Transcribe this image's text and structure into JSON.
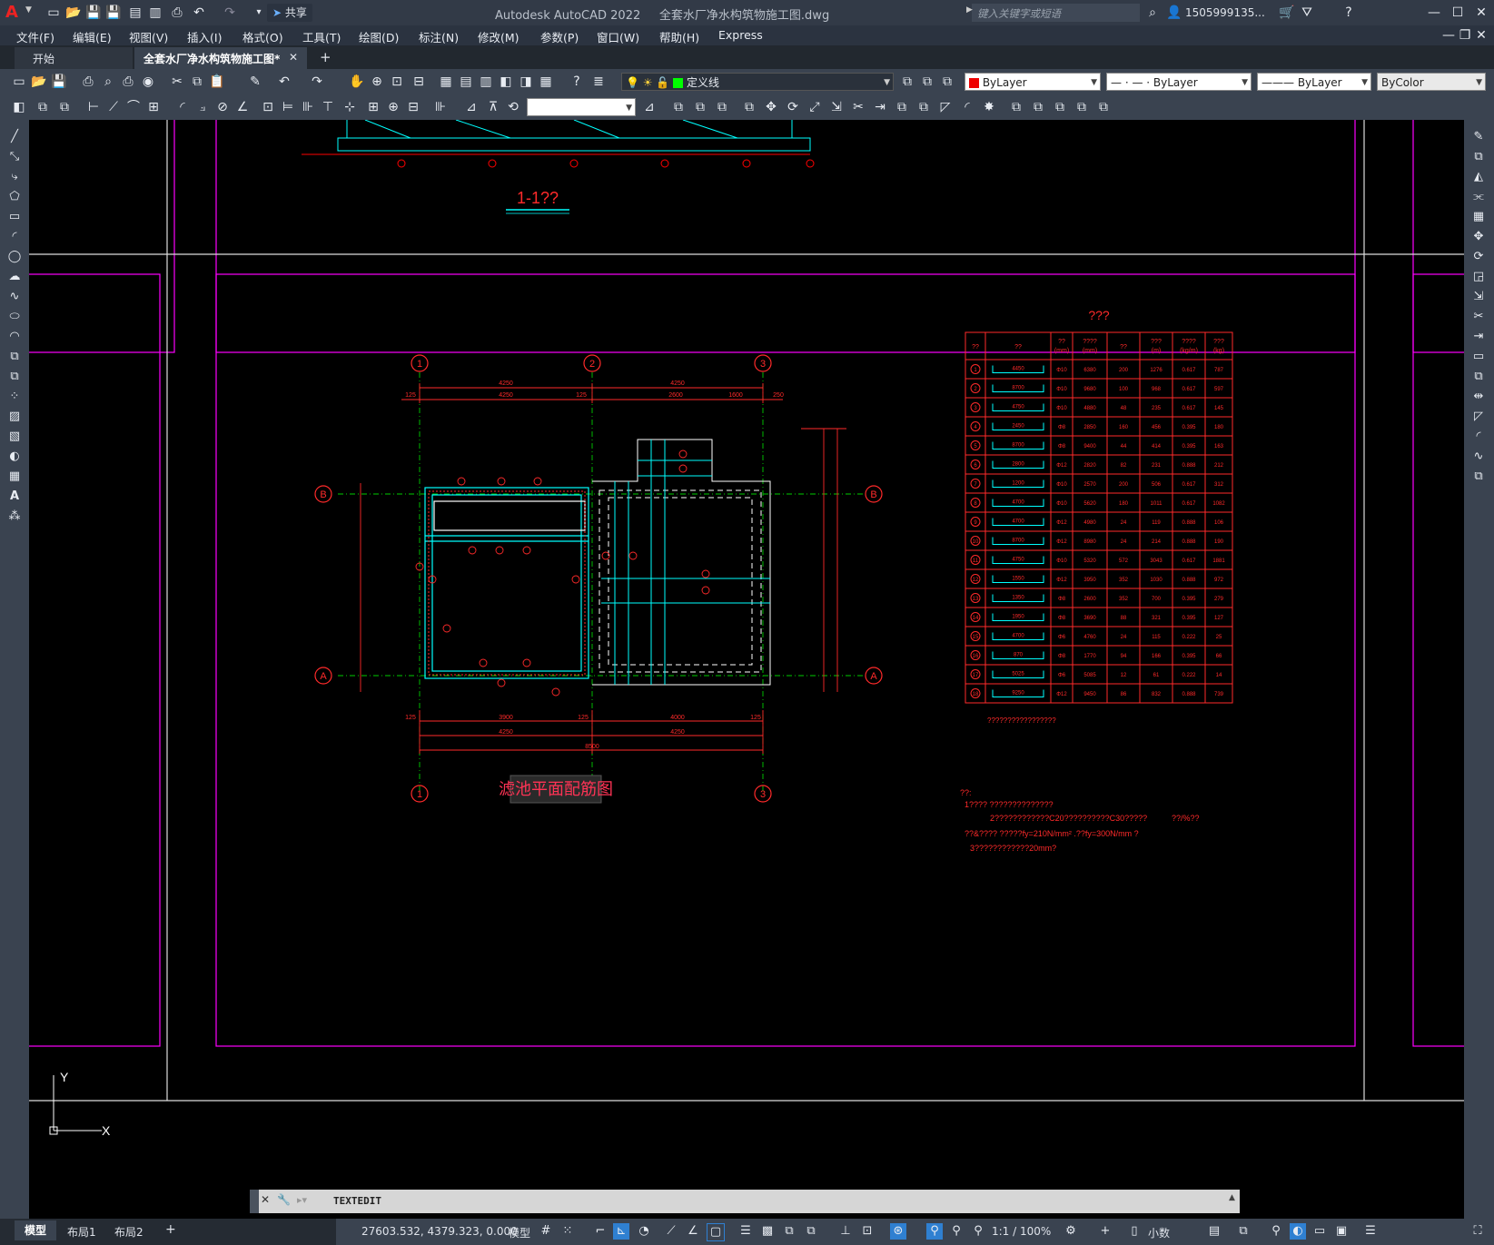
{
  "titlebar": {
    "app_title": "Autodesk AutoCAD 2022",
    "file_title": "全套水厂净水构筑物施工图.dwg",
    "share_label": "共享",
    "search_placeholder": "键入关键字或短语",
    "user": "1505999135..."
  },
  "menu": [
    "文件(F)",
    "编辑(E)",
    "视图(V)",
    "插入(I)",
    "格式(O)",
    "工具(T)",
    "绘图(D)",
    "标注(N)",
    "修改(M)",
    "参数(P)",
    "窗口(W)",
    "帮助(H)",
    "Express"
  ],
  "tabs": {
    "start": "开始",
    "doc": "全套水厂净水构筑物施工图*",
    "add": "+"
  },
  "layer_props": {
    "layer": "定义线",
    "color": "ByLayer",
    "linetype": "ByLayer",
    "lineweight": "ByLayer",
    "plotstyle": "ByColor"
  },
  "drawing": {
    "section_title": "1-1??",
    "plan_title": "滤池平面配筋图",
    "table_title": "???",
    "table_headers": [
      "??",
      "??",
      "??\n(mm)",
      "????\n(mm)",
      "??",
      "???\n(m)",
      "????\n(kg/m)",
      "???\n(kg)"
    ],
    "rebar_rows": [
      [
        "1",
        "4450",
        "Φ10",
        "6380",
        "200",
        "1276",
        "0.617",
        "787"
      ],
      [
        "2",
        "8700",
        "Φ10",
        "9680",
        "100",
        "968",
        "0.617",
        "597"
      ],
      [
        "3",
        "4750",
        "Φ10",
        "4880",
        "48",
        "235",
        "0.617",
        "145"
      ],
      [
        "4",
        "2450",
        "Φ8",
        "2850",
        "160",
        "456",
        "0.395",
        "180"
      ],
      [
        "5",
        "8700",
        "Φ8",
        "9400",
        "44",
        "414",
        "0.395",
        "163"
      ],
      [
        "6",
        "2800",
        "Φ12",
        "2820",
        "82",
        "231",
        "0.888",
        "212"
      ],
      [
        "7",
        "1200",
        "Φ10",
        "2570",
        "200",
        "506",
        "0.617",
        "312"
      ],
      [
        "8",
        "4700",
        "Φ10",
        "5620",
        "180",
        "1011",
        "0.617",
        "1082"
      ],
      [
        "9",
        "4700",
        "Φ12",
        "4980",
        "24",
        "119",
        "0.888",
        "106"
      ],
      [
        "10",
        "8700",
        "Φ12",
        "8980",
        "24",
        "214",
        "0.888",
        "190"
      ],
      [
        "11",
        "4750",
        "Φ10",
        "5320",
        "572",
        "3043",
        "0.617",
        "1881"
      ],
      [
        "12",
        "1550",
        "Φ12",
        "3950",
        "352",
        "1030",
        "0.888",
        "972"
      ],
      [
        "13",
        "1350",
        "Φ8",
        "2600",
        "352",
        "700",
        "0.395",
        "279"
      ],
      [
        "14",
        "1950",
        "Φ8",
        "3690",
        "88",
        "321",
        "0.395",
        "127"
      ],
      [
        "15",
        "4700",
        "Φ6",
        "4760",
        "24",
        "115",
        "0.222",
        "25"
      ],
      [
        "16",
        "870",
        "Φ8",
        "1770",
        "94",
        "166",
        "0.395",
        "66"
      ],
      [
        "17",
        "5025",
        "Φ6",
        "5085",
        "12",
        "61",
        "0.222",
        "14"
      ],
      [
        "18",
        "9250",
        "Φ12",
        "9450",
        "86",
        "832",
        "0.888",
        "739"
      ]
    ],
    "table_note": "?????????????????",
    "notes": [
      "??:",
      "1????          ??????????????",
      "2????????????C20??????????C30?????",
      "??&????     ?????fy=210N/mm²  .??fy=300N/mm   ?",
      "3????????????20mm?",
      "??/%??"
    ],
    "axis_labels": [
      "1",
      "2",
      "3",
      "A",
      "B"
    ],
    "dims_top": [
      "4250",
      "4250",
      "4250",
      "125",
      "125",
      "2600",
      "1600",
      "250"
    ],
    "dims_bottom": [
      "125",
      "3900",
      "125",
      "4000",
      "125",
      "4250",
      "4250",
      "8500"
    ]
  },
  "cmdline": {
    "text": "TEXTEDIT"
  },
  "layouts": [
    "模型",
    "布局1",
    "布局2",
    "+"
  ],
  "status": {
    "coords": "27603.532, 4379.323, 0.000",
    "model": "模型",
    "scale": "1:1 / 100%",
    "units": "小数"
  },
  "ucs": {
    "x": "X",
    "y": "Y"
  },
  "colors": {
    "accent": "#2f80d1",
    "cad_red": "#ff0000",
    "cad_cyan": "#00ffff",
    "cad_magenta": "#ff00ff"
  }
}
